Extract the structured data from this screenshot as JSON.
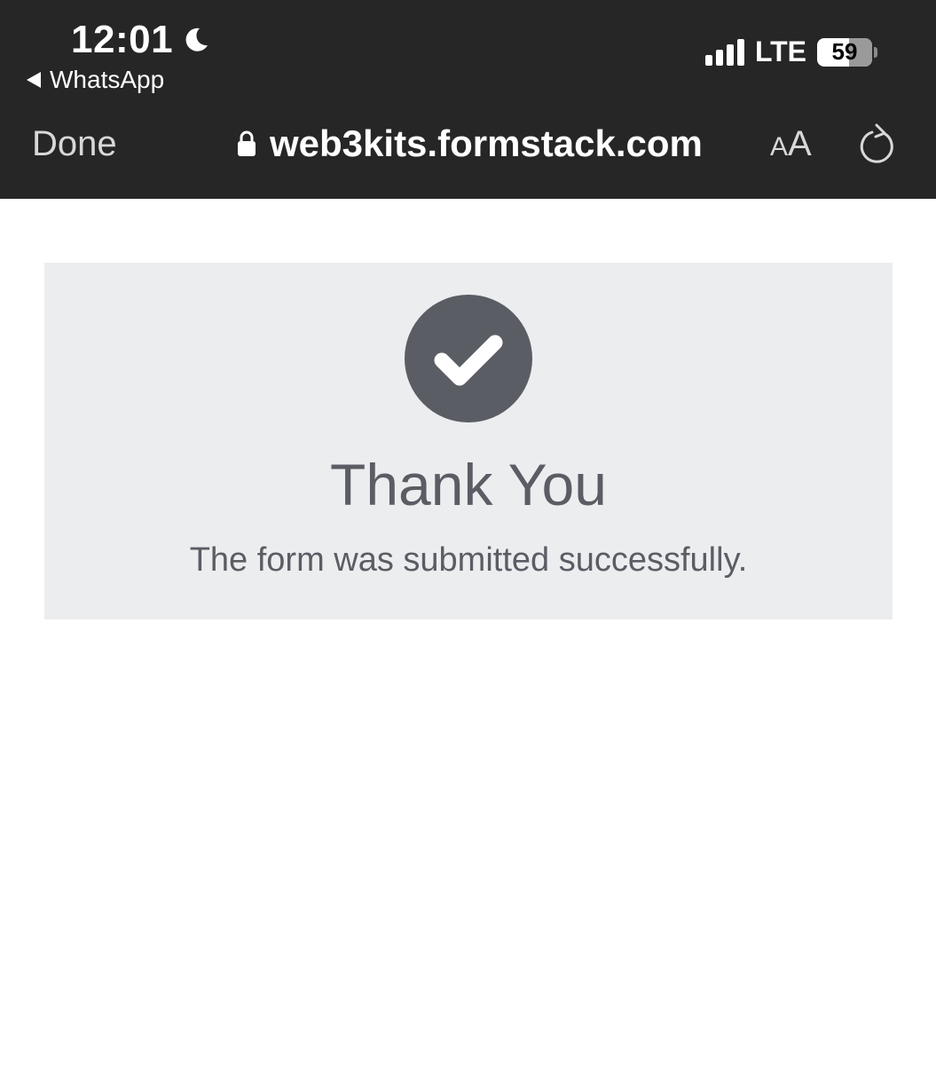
{
  "status_bar": {
    "time": "12:01",
    "back_app": "WhatsApp",
    "network": "LTE",
    "battery_percent": "59"
  },
  "browser_bar": {
    "done_label": "Done",
    "url": "web3kits.formstack.com",
    "text_size_small": "A",
    "text_size_big": "A"
  },
  "confirmation": {
    "title": "Thank You",
    "message": "The form was submitted successfully."
  },
  "icons": {
    "moon": "moon-icon",
    "lock": "lock-icon",
    "reload": "reload-icon",
    "check": "check-circle-icon",
    "back": "back-triangle-icon"
  },
  "colors": {
    "top_bar": "#262626",
    "card_background": "#ecedef",
    "accent_gray": "#5a5d64"
  }
}
